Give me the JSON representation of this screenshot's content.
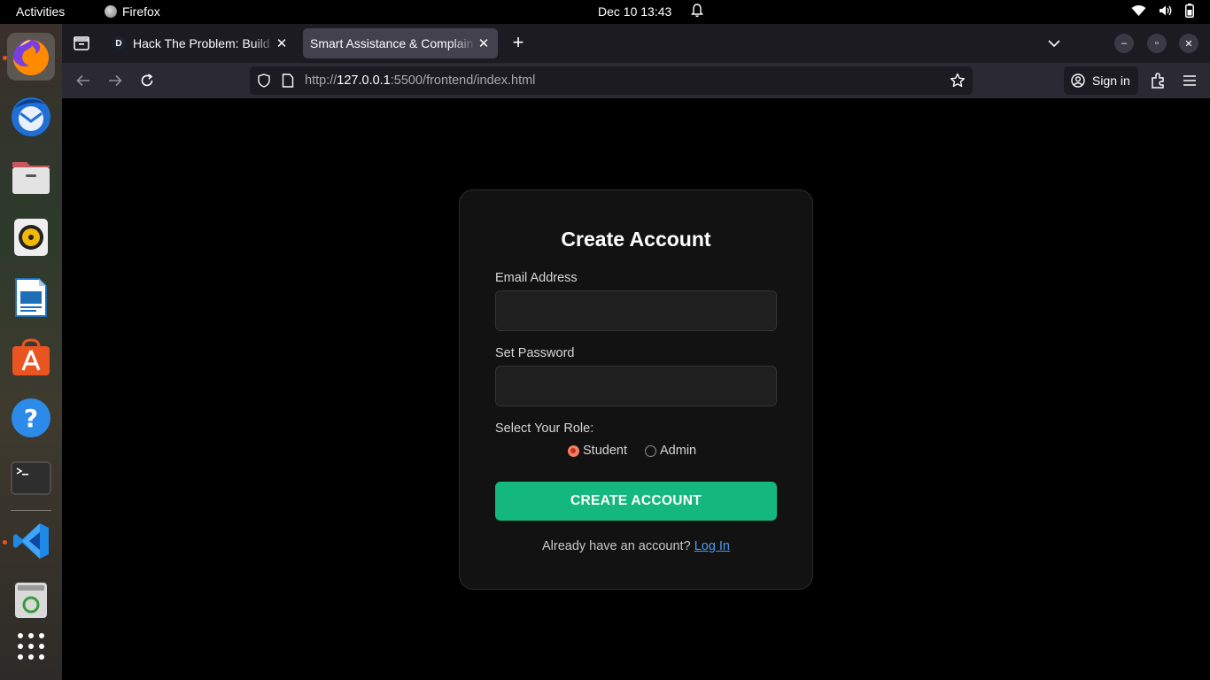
{
  "topbar": {
    "activities": "Activities",
    "app_name": "Firefox",
    "clock": "Dec 10  13:43"
  },
  "dock": {
    "items": [
      "Firefox",
      "Thunderbird",
      "Files",
      "Rhythmbox",
      "LibreOffice Writer",
      "Ubuntu Software",
      "Help",
      "Terminal",
      "Visual Studio Code",
      "Trash",
      "Show Apps"
    ]
  },
  "browser": {
    "tabs": [
      {
        "favicon": "D",
        "title": "Hack The Problem: Build",
        "active": false
      },
      {
        "title": "Smart Assistance & Complain",
        "active": true
      }
    ],
    "url_host": "127.0.0.1",
    "url_prefix": "http://",
    "url_path": ":5500/frontend/index.html",
    "signin_label": "Sign in"
  },
  "page": {
    "title": "Create Account",
    "email_label": "Email Address",
    "email_value": "",
    "password_label": "Set Password",
    "password_value": "",
    "role_label": "Select Your Role:",
    "roles": [
      {
        "label": "Student",
        "checked": true
      },
      {
        "label": "Admin",
        "checked": false
      }
    ],
    "submit_label": "CREATE ACCOUNT",
    "footer_text": "Already have an account? ",
    "login_link": "Log In"
  },
  "colors": {
    "accent_button": "#14b87f",
    "link": "#4a9bf2",
    "card_bg": "#121212",
    "radio_checked": "#f47f64"
  }
}
